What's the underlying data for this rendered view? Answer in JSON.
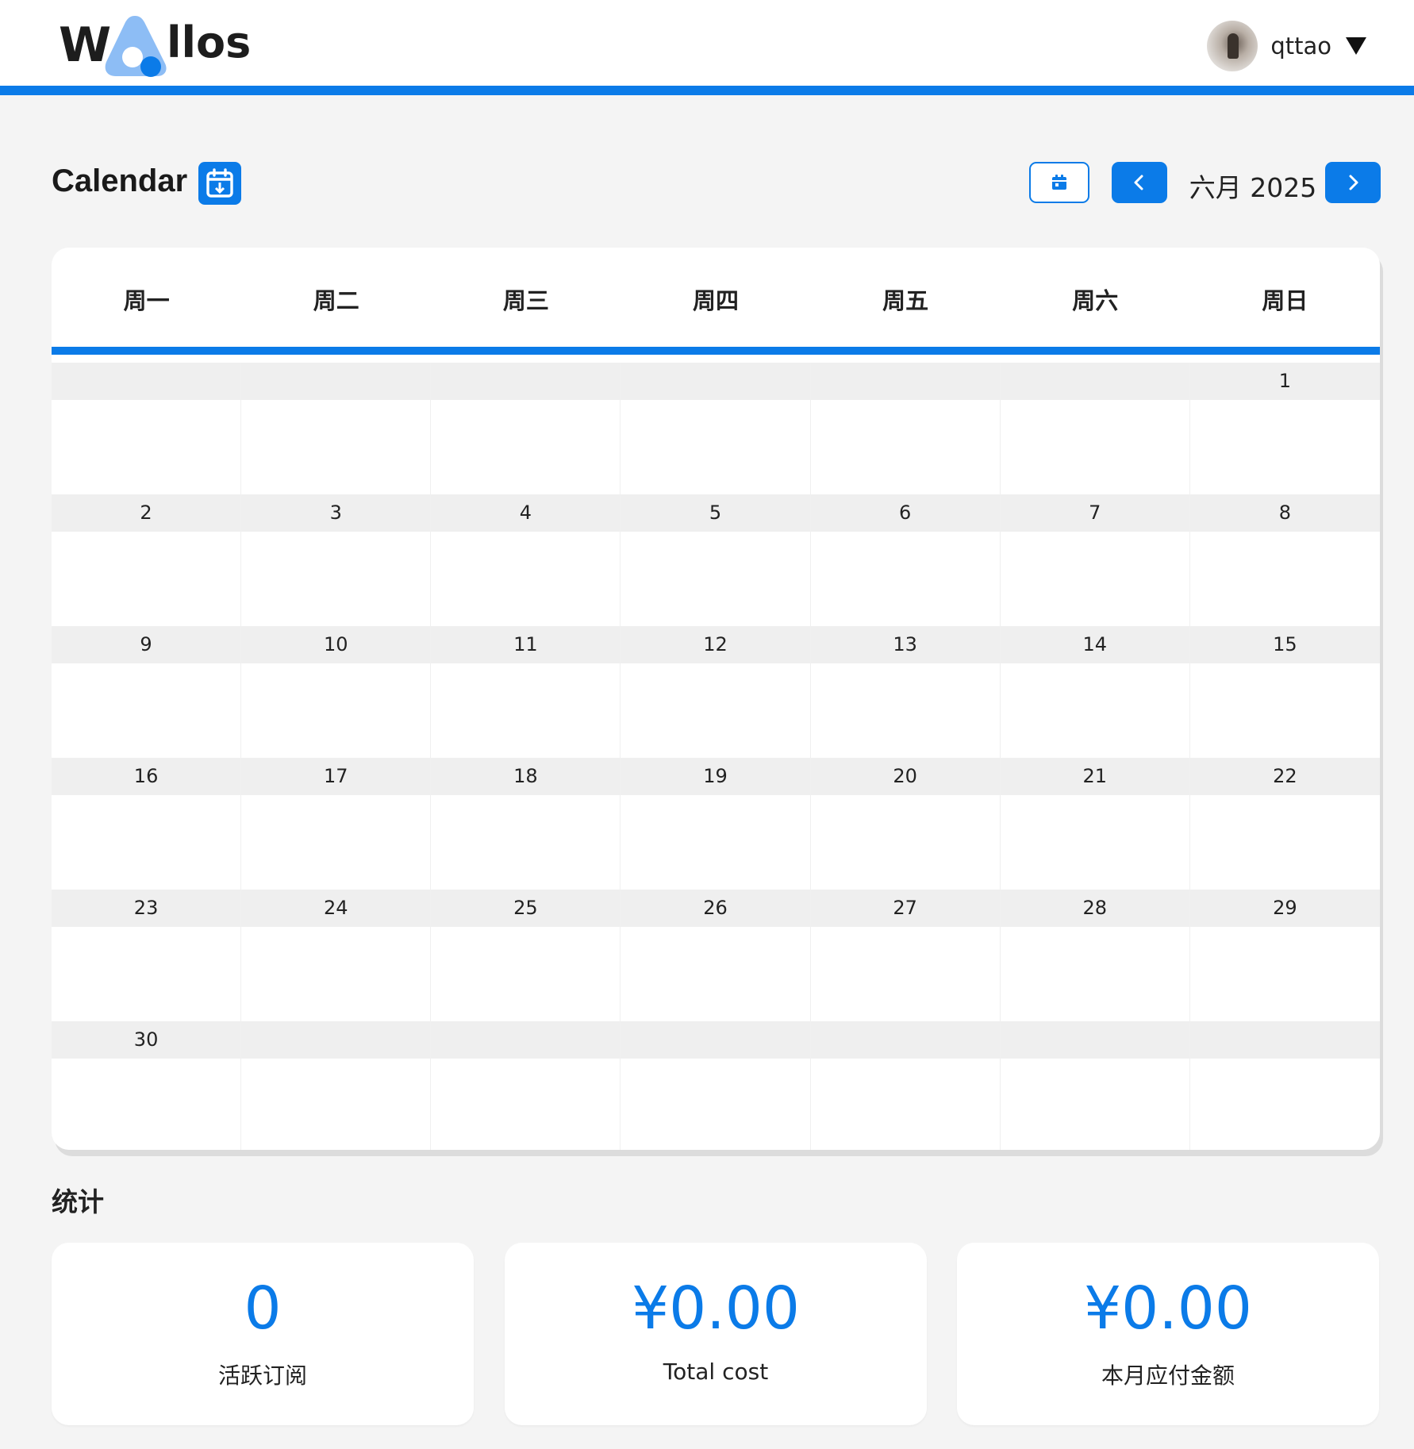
{
  "brand": {
    "logo_w": "W",
    "logo_rest": "llos"
  },
  "user": {
    "name": "qttao"
  },
  "calendar": {
    "title": "Calendar",
    "month_label": "六月 2025",
    "weekdays": [
      "周一",
      "周二",
      "周三",
      "周四",
      "周五",
      "周六",
      "周日"
    ],
    "weeks": [
      [
        "",
        "",
        "",
        "",
        "",
        "",
        "1"
      ],
      [
        "2",
        "3",
        "4",
        "5",
        "6",
        "7",
        "8"
      ],
      [
        "9",
        "10",
        "11",
        "12",
        "13",
        "14",
        "15"
      ],
      [
        "16",
        "17",
        "18",
        "19",
        "20",
        "21",
        "22"
      ],
      [
        "23",
        "24",
        "25",
        "26",
        "27",
        "28",
        "29"
      ],
      [
        "30",
        "",
        "",
        "",
        "",
        "",
        ""
      ]
    ]
  },
  "stats": {
    "title": "统计",
    "items": [
      {
        "value": "0",
        "label": "活跃订阅"
      },
      {
        "value": "¥0.00",
        "label": "Total cost"
      },
      {
        "value": "¥0.00",
        "label": "本月应付金额"
      }
    ]
  },
  "colors": {
    "accent": "#0b7be8",
    "logo_light": "#8dbdf5",
    "background": "#f4f4f4"
  },
  "icons": {
    "export": "calendar-download-icon",
    "today": "calendar-icon",
    "prev": "chevron-left-icon",
    "next": "chevron-right-icon",
    "user_menu": "caret-down-icon"
  }
}
